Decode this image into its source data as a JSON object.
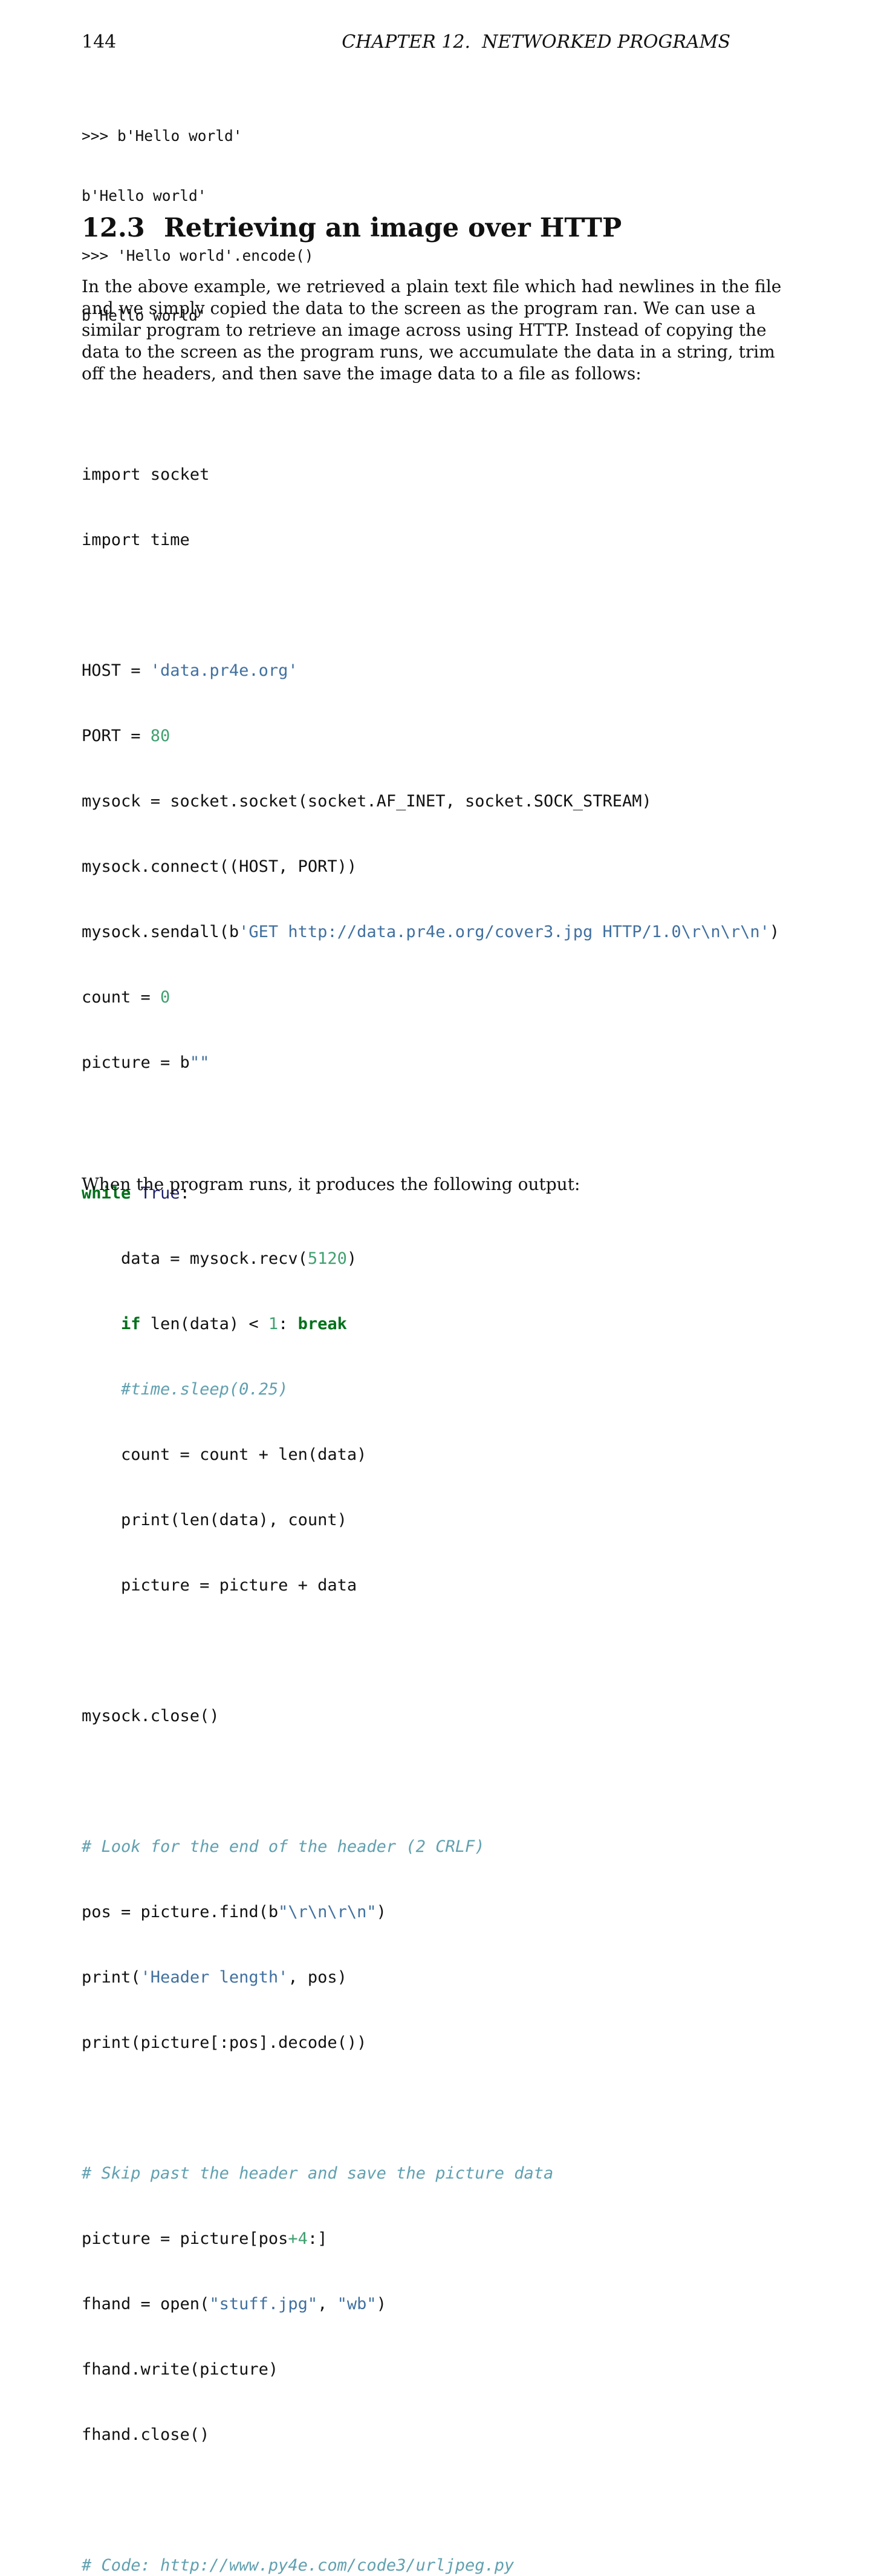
{
  "header": {
    "page_number": "144",
    "chapter": "CHAPTER 12.  NETWORKED PROGRAMS"
  },
  "repl_lines": [
    ">>> b'Hello world'",
    "b'Hello world'",
    ">>> 'Hello world'.encode()",
    "b'Hello world'"
  ],
  "section": {
    "number": "12.3",
    "title": "Retrieving an image over HTTP"
  },
  "paragraph_lines": [
    "In the above example, we retrieved a plain text file which had newlines in the file",
    "and we simply copied the data to the screen as the program ran.  We can use a",
    "similar program to retrieve an image across using HTTP. Instead of copying the",
    "data to the screen as the program runs, we accumulate the data in a string, trim",
    "off the headers, and then save the image data to a file as follows:"
  ],
  "code": {
    "l1": "import socket",
    "l2": "import time",
    "host_a": "HOST = ",
    "host_b": "'data.pr4e.org'",
    "port_a": "PORT = ",
    "port_b": "80",
    "l5": "mysock = socket.socket(socket.AF_INET, socket.SOCK_STREAM)",
    "l6": "mysock.connect((HOST, PORT))",
    "send_a": "mysock.sendall(b",
    "send_b": "'GET http://data.pr4e.org/cover3.jpg HTTP/1.0\\r\\n\\r\\n'",
    "send_c": ")",
    "count_a": "count = ",
    "count_b": "0",
    "pic_a": "picture = b",
    "pic_b": "\"\"",
    "while_kw": "while",
    "while_true": "True",
    "while_colon": ":",
    "recv_a": "    data = mysock.recv(",
    "recv_b": "5120",
    "recv_c": ")",
    "if_indent": "    ",
    "if_kw": "if",
    "if_mid": " len(data) < ",
    "if_num": "1",
    "if_colon": ": ",
    "break_kw": "break",
    "sleep_indent": "    ",
    "sleep_comment": "#time.sleep(0.25)",
    "l13": "    count = count + len(data)",
    "l14": "    print(len(data), count)",
    "l15": "    picture = picture + data",
    "l16": "mysock.close()",
    "comment1": "# Look for the end of the header (2 CRLF)",
    "find_a": "pos = picture.find(b",
    "find_b": "\"\\r\\n\\r\\n\"",
    "find_c": ")",
    "print_a": "print(",
    "print_b": "'Header length'",
    "print_c": ", pos)",
    "l19": "print(picture[:pos].decode())",
    "comment2": "# Skip past the header and save the picture data",
    "slice_a": "picture = picture[pos",
    "slice_b": "+4",
    "slice_c": ":]",
    "open_a": "fhand = open(",
    "open_b": "\"stuff.jpg\"",
    "open_c": ", ",
    "open_d": "\"wb\"",
    "open_e": ")",
    "l23": "fhand.write(picture)",
    "l24": "fhand.close()",
    "comment3": "# Code: http://www.py4e.com/code3/urljpeg.py"
  },
  "closing_paragraph": "When the program runs, it produces the following output:"
}
